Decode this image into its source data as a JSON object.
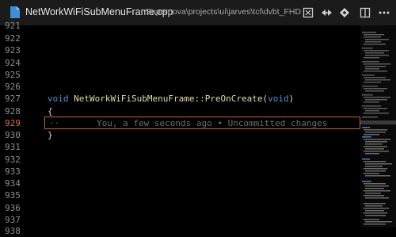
{
  "titlebar": {
    "file_name": "NetWorkWiFiSubMenuFrame.cpp",
    "file_path": "Supernova\\projects\\ui\\jarves\\tcl\\dvbt_FHD\\sr..."
  },
  "icons": {
    "file": "cpp-file-icon",
    "compare": "compare-changes-icon",
    "preview": "preview-icon",
    "git": "git-commit-icon",
    "split": "split-editor-icon",
    "more": "more-actions-icon"
  },
  "editor": {
    "lines": [
      {
        "number": "921",
        "code": ""
      },
      {
        "number": "922",
        "code": ""
      },
      {
        "number": "923",
        "code": ""
      },
      {
        "number": "924",
        "code": ""
      },
      {
        "number": "925",
        "code": ""
      },
      {
        "number": "926",
        "code": ""
      },
      {
        "number": "927",
        "code_kw1": "void",
        "code_fn": "NetWorkWiFiSubMenuFrame::PreOnCreate",
        "code_p1": "(",
        "code_kw2": "void",
        "code_p2": ")"
      },
      {
        "number": "928",
        "code": "{"
      },
      {
        "number": "929",
        "blame": "You, a few seconds ago • Uncommitted changes",
        "active": true
      },
      {
        "number": "930",
        "code": "}"
      },
      {
        "number": "931",
        "code": ""
      },
      {
        "number": "932",
        "code": ""
      },
      {
        "number": "933",
        "code": ""
      },
      {
        "number": "934",
        "code": ""
      },
      {
        "number": "935",
        "code": ""
      },
      {
        "number": "936",
        "code": ""
      },
      {
        "number": "937",
        "code": ""
      },
      {
        "number": "938",
        "code": ""
      }
    ]
  },
  "colors": {
    "background": "#000000",
    "titlebar": "#1b1b1b",
    "active_line_number": "#d7743f",
    "current_line_border": "#c2603a",
    "keyword": "#5a8fd6"
  }
}
